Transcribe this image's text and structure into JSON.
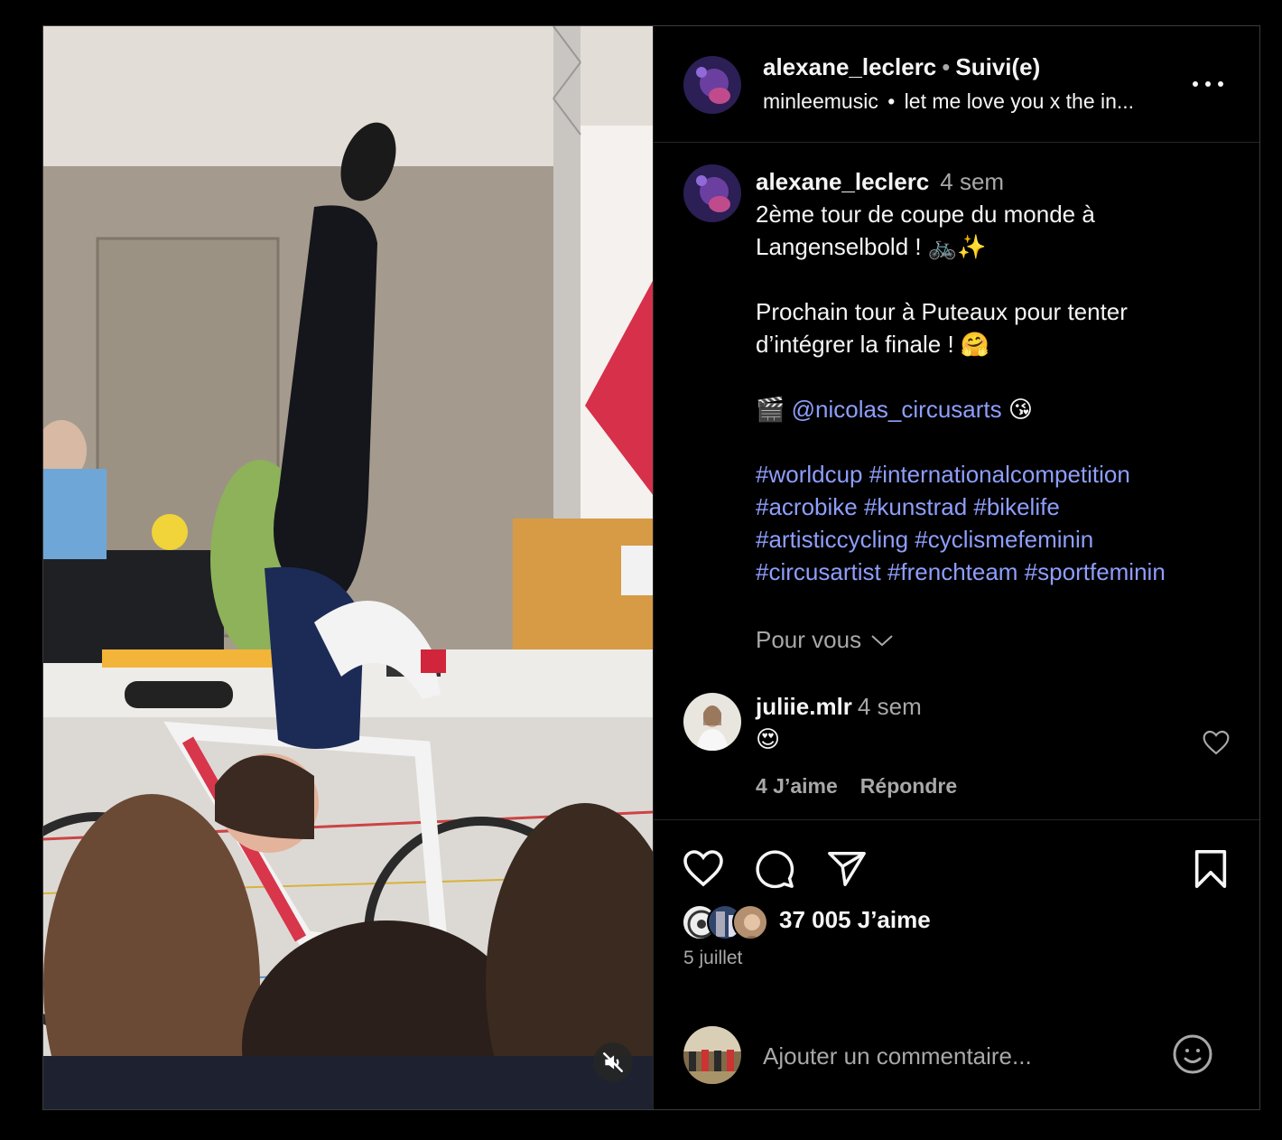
{
  "header": {
    "username": "alexane_leclerc",
    "separator": "•",
    "follow_status": "Suivi(e)",
    "audio_artist": "minleemusic",
    "audio_sep": "•",
    "audio_track": "let me love you x the in..."
  },
  "caption": {
    "username": "alexane_leclerc",
    "time": "4 sem",
    "line1": "2ème tour de coupe du monde à",
    "line2": "Langenselbold ! 🚲✨",
    "line3": "Prochain tour à Puteaux pour tenter",
    "line4": "d’intégrer la finale ! 🤗",
    "mention_prefix": "🎬",
    "mention": "@nicolas_circusarts",
    "mention_suffix": "😘",
    "hashtags": {
      "line1": [
        "#worldcup",
        "#internationalcompetition"
      ],
      "line2": [
        "#acrobike",
        "#kunstrad",
        "#bikelife"
      ],
      "line3": [
        "#artisticcycling",
        "#cyclismefeminin"
      ],
      "line4": [
        "#circusartist",
        "#frenchteam",
        "#sportfeminin"
      ]
    }
  },
  "for_you": "Pour vous",
  "comment": {
    "username": "juliie.mlr",
    "time": "4 sem",
    "text": "😍",
    "likes": "4 J’aime",
    "reply": "Répondre"
  },
  "post": {
    "likes": "37 005 J’aime",
    "date": "5 juillet"
  },
  "add_comment": {
    "placeholder": "Ajouter un commentaire..."
  },
  "icons": {
    "more": "more-icon",
    "like": "heart-icon",
    "comment": "comment-icon",
    "share": "send-icon",
    "save": "bookmark-icon",
    "emoji": "emoji-icon",
    "mute": "muted-speaker-icon",
    "chevron": "chevron-down-icon"
  },
  "colors": {
    "background": "#000000",
    "text": "#f5f5f5",
    "secondary": "#a8a8a8",
    "link": "#8e9efc",
    "border": "#262626"
  }
}
